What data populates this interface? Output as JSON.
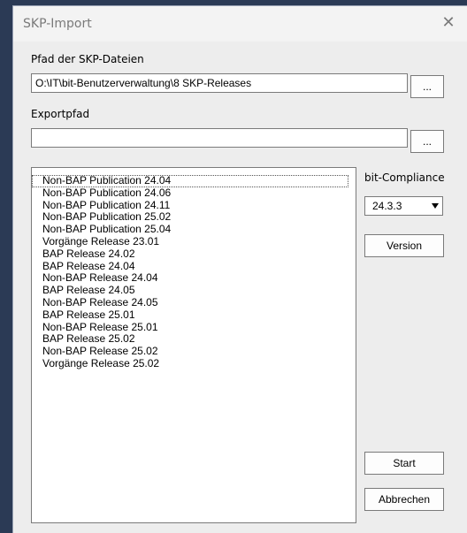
{
  "dialog": {
    "title": "SKP-Import",
    "close_glyph": "✕"
  },
  "skp_path": {
    "label": "Pfad der SKP-Dateien",
    "value": "O:\\IT\\bit-Benutzerverwaltung\\8 SKP-Releases",
    "browse_label": "..."
  },
  "export_path": {
    "label": "Exportpfad",
    "value": "",
    "browse_label": "..."
  },
  "release_list": {
    "items": [
      "Non-BAP Publication 24.04",
      "Non-BAP Publication 24.06",
      "Non-BAP Publication 24.11",
      "Non-BAP Publication 25.02",
      "Non-BAP Publication 25.04",
      "Vorgänge Release 23.01",
      "BAP Release 24.02",
      "BAP Release 24.04",
      "Non-BAP Release 24.04",
      "BAP Release 24.05",
      "Non-BAP Release 24.05",
      "BAP Release 25.01",
      "Non-BAP Release 25.01",
      "BAP Release 25.02",
      "Non-BAP Release 25.02",
      "Vorgänge Release 25.02"
    ],
    "selected_index": 0
  },
  "compliance": {
    "label": "bit-Compliance",
    "selected": "24.3.3",
    "version_label": "Version"
  },
  "actions": {
    "start_label": "Start",
    "cancel_label": "Abbrechen"
  },
  "icons": {
    "close": "close-icon",
    "dropdown": "chevron-down-icon"
  }
}
